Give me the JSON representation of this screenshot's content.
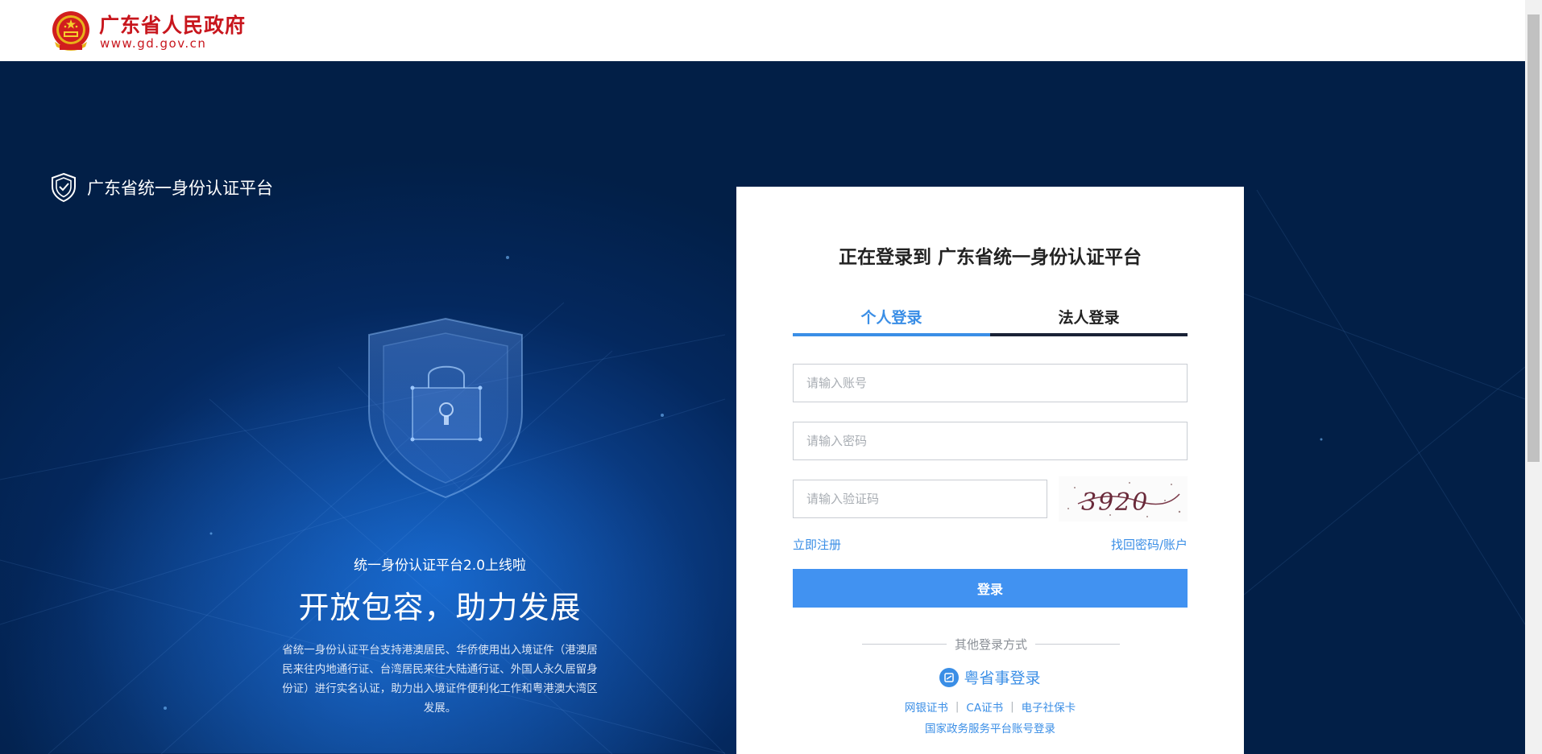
{
  "header": {
    "gov_title": "广东省人民政府",
    "gov_url": "www.gd.gov.cn"
  },
  "hero": {
    "platform_name": "广东省统一身份认证平台",
    "slogan_small": "统一身份认证平台2.0上线啦",
    "slogan_big": "开放包容，助力发展",
    "slogan_desc": "省统一身份认证平台支持港澳居民、华侨使用出入境证件（港澳居民来往内地通行证、台湾居民来往大陆通行证、外国人永久居留身份证）进行实名认证，助力出入境证件便利化工作和粤港澳大湾区发展。",
    "carousel_active_index": 2,
    "carousel_count": 2
  },
  "login": {
    "heading": "正在登录到 广东省统一身份认证平台",
    "tabs": [
      {
        "label": "个人登录",
        "active": true
      },
      {
        "label": "法人登录",
        "active": false
      }
    ],
    "account_placeholder": "请输入账号",
    "password_placeholder": "请输入密码",
    "captcha_placeholder": "请输入验证码",
    "captcha_text": "3920",
    "register_link": "立即注册",
    "recover_link": "找回密码/账户",
    "submit_label": "登录",
    "other_methods_label": "其他登录方式",
    "yss_label": "粤省事登录",
    "alt_links": [
      "网银证书",
      "CA证书",
      "电子社保卡"
    ],
    "national_link": "国家政务服务平台账号登录"
  },
  "colors": {
    "gov_red": "#c8161d",
    "accent_blue": "#3a8ee6",
    "button_blue": "#4192f1",
    "hero_dark": "#021f47"
  }
}
